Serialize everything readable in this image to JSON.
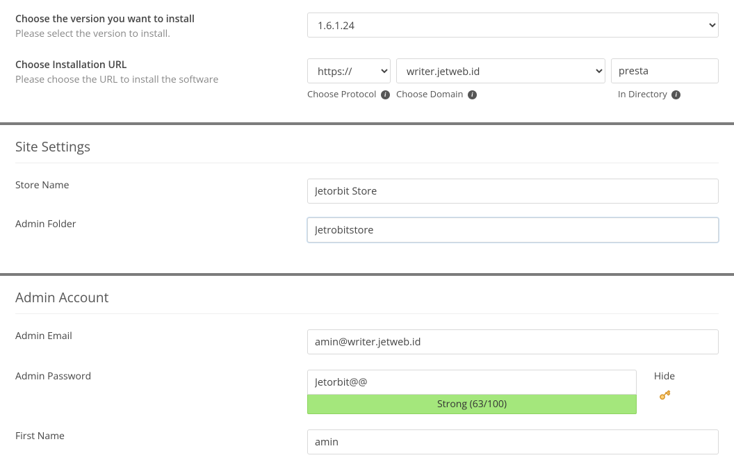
{
  "version": {
    "label": "Choose the version you want to install",
    "desc": "Please select the version to install.",
    "value": "1.6.1.24"
  },
  "install_url": {
    "label": "Choose Installation URL",
    "desc": "Please choose the URL to install the software",
    "protocol": "https://",
    "domain": "writer.jetweb.id",
    "directory": "presta",
    "sub_protocol": "Choose Protocol",
    "sub_domain": "Choose Domain",
    "sub_directory": "In Directory"
  },
  "site_settings_title": "Site Settings",
  "store_name": {
    "label": "Store Name",
    "value": "Jetorbit Store"
  },
  "admin_folder": {
    "label": "Admin Folder",
    "value": "Jetrobitstore"
  },
  "admin_account_title": "Admin Account",
  "admin_email": {
    "label": "Admin Email",
    "value": "amin@writer.jetweb.id"
  },
  "admin_password": {
    "label": "Admin Password",
    "value": "Jetorbit@@",
    "strength": "Strong (63/100)",
    "toggle": "Hide"
  },
  "first_name": {
    "label": "First Name",
    "value": "amin"
  },
  "info_char": "i"
}
